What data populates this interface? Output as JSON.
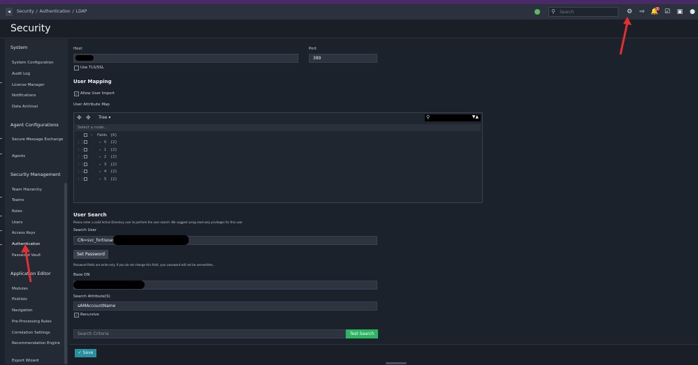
{
  "breadcrumb": [
    "Security",
    "/",
    "Authentication",
    "/",
    "LDAP"
  ],
  "search": {
    "placeholder": "Search"
  },
  "header": {
    "title": "Security",
    "notification_count": "2"
  },
  "sidebar": {
    "sections": [
      {
        "title": "System",
        "items": [
          "System Configuration",
          "Audit Log",
          "License Manager",
          "Notifications",
          "Data Archival"
        ]
      },
      {
        "title": "Agent Configurations",
        "items": [
          "Secure Message Exchange",
          "Agents"
        ]
      },
      {
        "title": "Security Management",
        "items": [
          "Team Hierarchy",
          "Teams",
          "Roles",
          "Users",
          "Access Keys",
          "Authentication",
          "Password Vault"
        ]
      },
      {
        "title": "Application Editor",
        "items": [
          "Modules",
          "Picklists",
          "Navigation",
          "Pre-Processing Rules",
          "Correlation Settings",
          "Recommendation Engine",
          "Export Wizard"
        ]
      }
    ],
    "active_item": "Authentication"
  },
  "connection": {
    "host_label": "Host",
    "port_label": "Port",
    "port_value": "389",
    "tls_label": "Use TLS/SSL"
  },
  "user_mapping": {
    "title": "User Mapping",
    "allow_import_label": "Allow User Import",
    "attribute_map_label": "User Attribute Map",
    "view_mode": "Tree",
    "select_placeholder": "Select a node...",
    "tree_root": {
      "name": "Fields",
      "count": "{6}"
    },
    "tree_children": [
      {
        "name": "0",
        "count": "{2}"
      },
      {
        "name": "1",
        "count": "{2}"
      },
      {
        "name": "2",
        "count": "{2}"
      },
      {
        "name": "3",
        "count": "{2}"
      },
      {
        "name": "4",
        "count": "{2}"
      },
      {
        "name": "5",
        "count": "{2}"
      }
    ]
  },
  "user_search": {
    "title": "User Search",
    "description": "Please enter a valid Active Directory user to perform the user search. We suggest using read-only privileges for this user.",
    "search_user_label": "Search User",
    "search_user_value": "CN=svc_fortisoar_",
    "set_password_label": "Set Password",
    "password_note": "Password fields are write-only. If you do not change this field, your password will not be overwritten..",
    "base_dn_label": "Base DN",
    "search_attribute_label": "Search Attribute(S)",
    "search_attribute_value": "sAMAccountName",
    "recursive_label": "Recursive",
    "criteria_placeholder": "Search Criteria",
    "test_search_label": "Test Search"
  },
  "footer": {
    "save_label": "Save"
  },
  "icons": [
    "back-icon",
    "status-icon",
    "search-icon",
    "settings-icon",
    "share-icon",
    "bell-icon",
    "tasks-icon",
    "monitor-icon",
    "user-icon",
    "move-icon",
    "search-icon",
    "expand-icon",
    "collapse-icon",
    "drag-icon",
    "check-icon"
  ],
  "colors": {
    "accent_green": "#2fb463",
    "save_teal": "#2a8f9e",
    "annotation_red": "#e03030",
    "top_strip": "#4a2a66"
  }
}
